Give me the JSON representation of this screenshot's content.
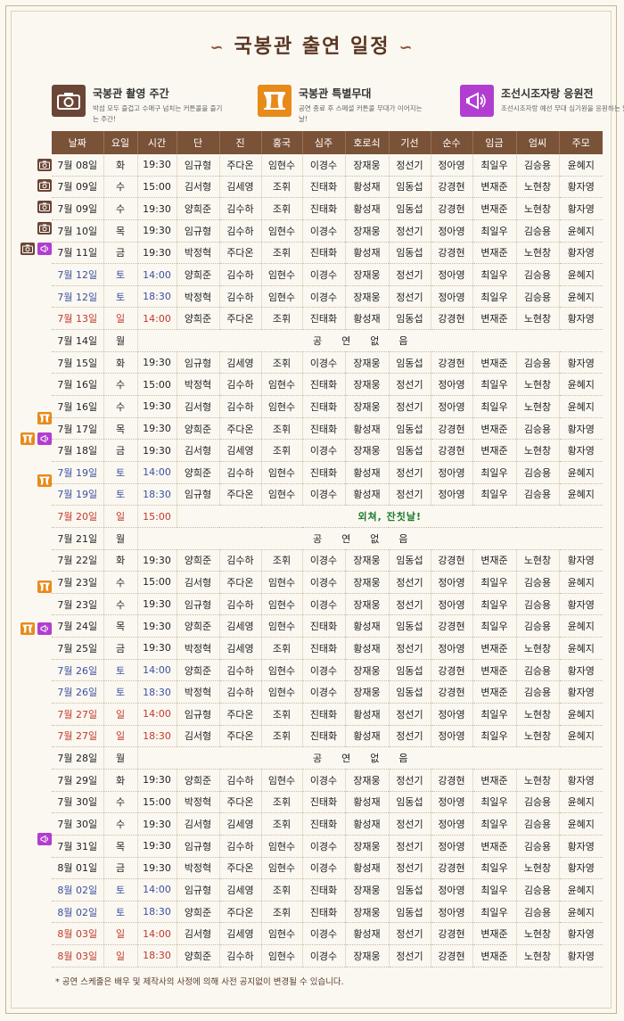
{
  "title": "국봉관 출연 일정",
  "legend": [
    {
      "icon": "camera-icon",
      "color": "#6b4636",
      "title": "국봉관 촬영 주간",
      "desc": "박섬 모두 즐겁고 수매구 넘치는 커튼콜을 즐기는 주간!"
    },
    {
      "icon": "stage-curtain-icon",
      "color": "#e88a1a",
      "title": "국봉관 특별무대",
      "desc": "공연 종료 후 스페셜 커튼콜 무대가 이어지는 날!"
    },
    {
      "icon": "megaphone-icon",
      "color": "#b13ed0",
      "title": "조선시조자랑 응원전",
      "desc": "조선시조자랑 예선 무대 심기원을 응원하는 날!"
    }
  ],
  "headers": [
    "날짜",
    "요일",
    "시간",
    "단",
    "진",
    "홍국",
    "심주",
    "호로쇠",
    "기선",
    "순수",
    "임금",
    "엄씨",
    "주모"
  ],
  "rows": [
    {
      "marks": [
        "cam"
      ],
      "date": "7월 08일",
      "day": "화",
      "time": "19:30",
      "cast": [
        "임규형",
        "주다온",
        "임현수",
        "이경수",
        "장재웅",
        "정선기",
        "정아영",
        "최일우",
        "김승용",
        "윤혜지"
      ]
    },
    {
      "marks": [
        "cam"
      ],
      "date": "7월 09일",
      "day": "수",
      "time": "15:00",
      "cast": [
        "김서형",
        "김세영",
        "조휘",
        "진태화",
        "황성재",
        "임동섭",
        "강경현",
        "변재준",
        "노현창",
        "황자영"
      ]
    },
    {
      "marks": [
        "cam"
      ],
      "date": "7월 09일",
      "day": "수",
      "time": "19:30",
      "cast": [
        "양희준",
        "김수하",
        "조휘",
        "진태화",
        "황성재",
        "임동섭",
        "강경현",
        "변재준",
        "노현창",
        "황자영"
      ]
    },
    {
      "marks": [
        "cam"
      ],
      "date": "7월 10일",
      "day": "목",
      "time": "19:30",
      "cast": [
        "임규형",
        "김수하",
        "임현수",
        "이경수",
        "장재웅",
        "정선기",
        "정아영",
        "최일우",
        "김승용",
        "윤혜지"
      ]
    },
    {
      "marks": [
        "cam",
        "cheer"
      ],
      "date": "7월 11일",
      "day": "금",
      "time": "19:30",
      "cast": [
        "박정혁",
        "주다온",
        "조휘",
        "진태화",
        "황성재",
        "임동섭",
        "강경현",
        "변재준",
        "노현창",
        "황자영"
      ]
    },
    {
      "marks": [],
      "type": "sat",
      "date": "7월 12일",
      "day": "토",
      "time": "14:00",
      "cast": [
        "양희준",
        "김수하",
        "임현수",
        "이경수",
        "장재웅",
        "정선기",
        "정아영",
        "최일우",
        "김승용",
        "윤혜지"
      ]
    },
    {
      "marks": [],
      "type": "sat",
      "date": "7월 12일",
      "day": "토",
      "time": "18:30",
      "cast": [
        "박정혁",
        "김수하",
        "임현수",
        "이경수",
        "장재웅",
        "정선기",
        "정아영",
        "최일우",
        "김승용",
        "윤혜지"
      ]
    },
    {
      "marks": [],
      "type": "sun",
      "date": "7월 13일",
      "day": "일",
      "time": "14:00",
      "cast": [
        "양희준",
        "주다온",
        "조휘",
        "진태화",
        "황성재",
        "임동섭",
        "강경현",
        "변재준",
        "노현창",
        "황자영"
      ]
    },
    {
      "marks": [],
      "date": "7월 14일",
      "day": "월",
      "note": "공연없음"
    },
    {
      "marks": [],
      "date": "7월 15일",
      "day": "화",
      "time": "19:30",
      "cast": [
        "임규형",
        "김세영",
        "조휘",
        "이경수",
        "장재웅",
        "임동섭",
        "강경현",
        "변재준",
        "김승용",
        "황자영"
      ]
    },
    {
      "marks": [],
      "date": "7월 16일",
      "day": "수",
      "time": "15:00",
      "cast": [
        "박정혁",
        "김수하",
        "임현수",
        "진태화",
        "장재웅",
        "정선기",
        "정아영",
        "최일우",
        "노현창",
        "윤혜지"
      ]
    },
    {
      "marks": [],
      "date": "7월 16일",
      "day": "수",
      "time": "19:30",
      "cast": [
        "김서형",
        "김수하",
        "임현수",
        "진태화",
        "장재웅",
        "정선기",
        "정아영",
        "최일우",
        "노현창",
        "윤혜지"
      ]
    },
    {
      "marks": [
        "stage"
      ],
      "date": "7월 17일",
      "day": "목",
      "time": "19:30",
      "cast": [
        "양희준",
        "주다온",
        "조휘",
        "진태화",
        "황성재",
        "임동섭",
        "강경현",
        "변재준",
        "김승용",
        "황자영"
      ]
    },
    {
      "marks": [
        "stage",
        "cheer"
      ],
      "date": "7월 18일",
      "day": "금",
      "time": "19:30",
      "cast": [
        "김서형",
        "김세영",
        "조휘",
        "이경수",
        "장재웅",
        "임동섭",
        "강경현",
        "변재준",
        "노현창",
        "황자영"
      ]
    },
    {
      "marks": [],
      "type": "sat",
      "date": "7월 19일",
      "day": "토",
      "time": "14:00",
      "cast": [
        "양희준",
        "김수하",
        "임현수",
        "진태화",
        "황성재",
        "정선기",
        "정아영",
        "최일우",
        "김승용",
        "윤혜지"
      ]
    },
    {
      "marks": [
        "stage"
      ],
      "type": "sat",
      "date": "7월 19일",
      "day": "토",
      "time": "18:30",
      "cast": [
        "임규형",
        "주다온",
        "임현수",
        "이경수",
        "황성재",
        "정선기",
        "정아영",
        "최일우",
        "김승용",
        "윤혜지"
      ]
    },
    {
      "marks": [],
      "type": "sun",
      "date": "7월 20일",
      "day": "일",
      "time": "15:00",
      "event": "외쳐, 잔칫날!"
    },
    {
      "marks": [],
      "date": "7월 21일",
      "day": "월",
      "note": "공연없음"
    },
    {
      "marks": [],
      "date": "7월 22일",
      "day": "화",
      "time": "19:30",
      "cast": [
        "양희준",
        "김수하",
        "조휘",
        "이경수",
        "장재웅",
        "임동섭",
        "강경현",
        "변재준",
        "노현창",
        "황자영"
      ]
    },
    {
      "marks": [],
      "date": "7월 23일",
      "day": "수",
      "time": "15:00",
      "cast": [
        "김서형",
        "주다온",
        "임현수",
        "이경수",
        "장재웅",
        "정선기",
        "정아영",
        "최일우",
        "김승용",
        "윤혜지"
      ]
    },
    {
      "marks": [
        "stage"
      ],
      "date": "7월 23일",
      "day": "수",
      "time": "19:30",
      "cast": [
        "임규형",
        "김수하",
        "임현수",
        "이경수",
        "장재웅",
        "정선기",
        "정아영",
        "최일우",
        "김승용",
        "황자영"
      ]
    },
    {
      "marks": [],
      "date": "7월 24일",
      "day": "목",
      "time": "19:30",
      "cast": [
        "양희준",
        "김세영",
        "임현수",
        "진태화",
        "황성재",
        "임동섭",
        "강경현",
        "최일우",
        "김승용",
        "윤혜지"
      ]
    },
    {
      "marks": [
        "stage",
        "cheer"
      ],
      "date": "7월 25일",
      "day": "금",
      "time": "19:30",
      "cast": [
        "박정혁",
        "김세영",
        "조휘",
        "진태화",
        "황성재",
        "정선기",
        "정아영",
        "변재준",
        "노현창",
        "윤혜지"
      ]
    },
    {
      "marks": [],
      "type": "sat",
      "date": "7월 26일",
      "day": "토",
      "time": "14:00",
      "cast": [
        "양희준",
        "김수하",
        "임현수",
        "이경수",
        "장재웅",
        "임동섭",
        "강경현",
        "변재준",
        "김승용",
        "황자영"
      ]
    },
    {
      "marks": [],
      "type": "sat",
      "date": "7월 26일",
      "day": "토",
      "time": "18:30",
      "cast": [
        "박정혁",
        "김수하",
        "임현수",
        "이경수",
        "장재웅",
        "임동섭",
        "강경현",
        "변재준",
        "김승용",
        "황자영"
      ]
    },
    {
      "marks": [],
      "type": "sun",
      "date": "7월 27일",
      "day": "일",
      "time": "14:00",
      "cast": [
        "임규형",
        "주다온",
        "조휘",
        "진태화",
        "황성재",
        "정선기",
        "정아영",
        "최일우",
        "노현창",
        "윤혜지"
      ]
    },
    {
      "marks": [],
      "type": "sun",
      "date": "7월 27일",
      "day": "일",
      "time": "18:30",
      "cast": [
        "김서형",
        "주다온",
        "조휘",
        "진태화",
        "황성재",
        "정선기",
        "정아영",
        "최일우",
        "노현창",
        "윤혜지"
      ]
    },
    {
      "marks": [],
      "date": "7월 28일",
      "day": "월",
      "note": "공연없음"
    },
    {
      "marks": [],
      "date": "7월 29일",
      "day": "화",
      "time": "19:30",
      "cast": [
        "양희준",
        "김수하",
        "임현수",
        "이경수",
        "장재웅",
        "정선기",
        "강경현",
        "변재준",
        "노현창",
        "황자영"
      ]
    },
    {
      "marks": [],
      "date": "7월 30일",
      "day": "수",
      "time": "15:00",
      "cast": [
        "박정혁",
        "주다온",
        "조휘",
        "진태화",
        "황성재",
        "임동섭",
        "정아영",
        "최일우",
        "김승용",
        "윤혜지"
      ]
    },
    {
      "marks": [],
      "date": "7월 30일",
      "day": "수",
      "time": "19:30",
      "cast": [
        "김서형",
        "김세영",
        "조휘",
        "진태화",
        "황성재",
        "정선기",
        "정아영",
        "최일우",
        "김승용",
        "윤혜지"
      ]
    },
    {
      "marks": [],
      "date": "7월 31일",
      "day": "목",
      "time": "19:30",
      "cast": [
        "임규형",
        "김수하",
        "임현수",
        "이경수",
        "장재웅",
        "정선기",
        "정아영",
        "변재준",
        "김승용",
        "황자영"
      ]
    },
    {
      "marks": [
        "cheer"
      ],
      "date": "8월 01일",
      "day": "금",
      "time": "19:30",
      "cast": [
        "박정혁",
        "주다온",
        "임현수",
        "이경수",
        "황성재",
        "정선기",
        "강경현",
        "최일우",
        "노현창",
        "황자영"
      ]
    },
    {
      "marks": [],
      "type": "sat",
      "date": "8월 02일",
      "day": "토",
      "time": "14:00",
      "cast": [
        "임규형",
        "김세영",
        "조휘",
        "진태화",
        "장재웅",
        "임동섭",
        "정아영",
        "최일우",
        "김승용",
        "윤혜지"
      ]
    },
    {
      "marks": [],
      "type": "sat",
      "date": "8월 02일",
      "day": "토",
      "time": "18:30",
      "cast": [
        "양희준",
        "주다온",
        "조휘",
        "진태화",
        "장재웅",
        "임동섭",
        "정아영",
        "최일우",
        "김승용",
        "윤혜지"
      ]
    },
    {
      "marks": [],
      "type": "sun",
      "date": "8월 03일",
      "day": "일",
      "time": "14:00",
      "cast": [
        "김서형",
        "김세영",
        "임현수",
        "이경수",
        "황성재",
        "정선기",
        "강경현",
        "변재준",
        "노현창",
        "황자영"
      ]
    },
    {
      "marks": [],
      "type": "sun",
      "date": "8월 03일",
      "day": "일",
      "time": "18:30",
      "cast": [
        "양희준",
        "김수하",
        "임현수",
        "이경수",
        "장재웅",
        "정선기",
        "강경현",
        "변재준",
        "노현창",
        "황자영"
      ]
    }
  ],
  "footnote": "* 공연 스케줄은 배우 및 제작사의 사정에 의해 사전 공지없이 변경될 수 있습니다."
}
